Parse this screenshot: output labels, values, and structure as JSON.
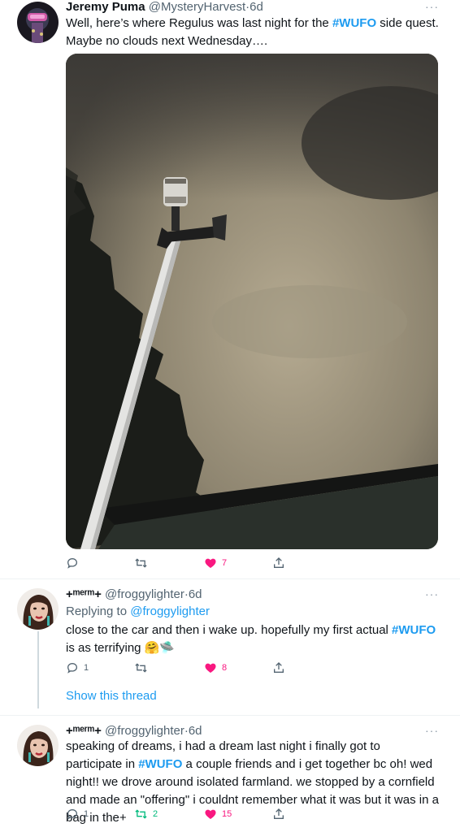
{
  "colors": {
    "link": "#1d9bf0",
    "like": "#f91880",
    "retweet_active": "#00ba7c",
    "muted": "#536471"
  },
  "tweets": [
    {
      "name": "Jeremy Puma",
      "handle": "@MysteryHarvest",
      "time": "6d",
      "more": "···",
      "text_prefix": "Well, here’s where Regulus was last night for the ",
      "hashtag": "#WUFO",
      "text_suffix": " side quest. Maybe no clouds next Wednesday….",
      "actions": {
        "reply": "",
        "retweet": "",
        "like": "7",
        "liked": true
      }
    },
    {
      "name": "+ᵐᵉʳᵐ+",
      "handle": "@froggylighter",
      "time": "6d",
      "more": "···",
      "replying_prefix": "Replying to ",
      "replying_to": "@froggylighter",
      "text_prefix": "close to the car and then i wake up. hopefully my first actual ",
      "hashtag": "#WUFO",
      "text_suffix": " is as terrifying ",
      "emoji": "🤗🛸",
      "actions": {
        "reply": "1",
        "retweet": "",
        "like": "8",
        "liked": true
      }
    },
    {
      "name": "+ᵐᵉʳᵐ+",
      "handle": "@froggylighter",
      "time": "6d",
      "more": "···",
      "text_prefix": "speaking of dreams, i had a dream last night i finally got to participate in ",
      "hashtag": "#WUFO",
      "text_suffix": " a couple friends and i get together bc oh! wed night!! we drove around isolated farmland. we stopped by a cornfield and made an \"offering\" i couldnt remember what it was but it was in a bag in the+",
      "actions": {
        "reply": "1",
        "retweet": "2",
        "like": "15",
        "liked": true,
        "retweeted": true
      }
    }
  ],
  "show_thread": "Show this thread",
  "dot": "·"
}
